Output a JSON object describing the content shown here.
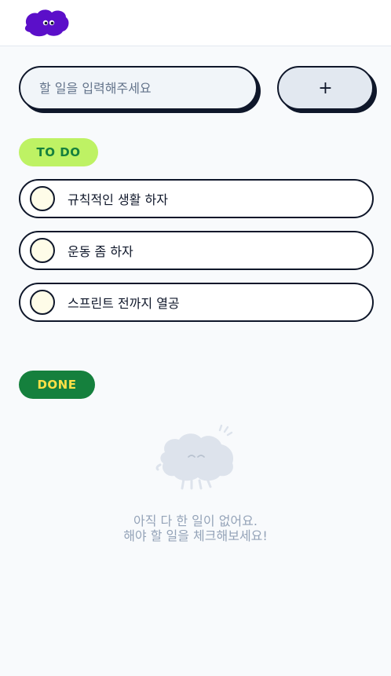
{
  "header": {
    "logo_icon": "purple-blob-mascot-icon",
    "brand_color": "#5b0fc9"
  },
  "input": {
    "placeholder": "할 일을 입력해주세요",
    "value": ""
  },
  "add_button": {
    "label": "+"
  },
  "todo_section": {
    "badge_label": "TO DO",
    "badge_color": "#bef264",
    "items": [
      {
        "label": "규칙적인 생활 하자",
        "checked": false
      },
      {
        "label": "운동 좀 하자",
        "checked": false
      },
      {
        "label": "스프린트 전까지 열공",
        "checked": false
      }
    ]
  },
  "done_section": {
    "badge_label": "DONE",
    "badge_color": "#15803d",
    "empty_icon": "sleeping-blob-icon",
    "empty_message_line1": "아직 다 한 일이 없어요.",
    "empty_message_line2": "해야 할 일을 체크해보세요!"
  }
}
